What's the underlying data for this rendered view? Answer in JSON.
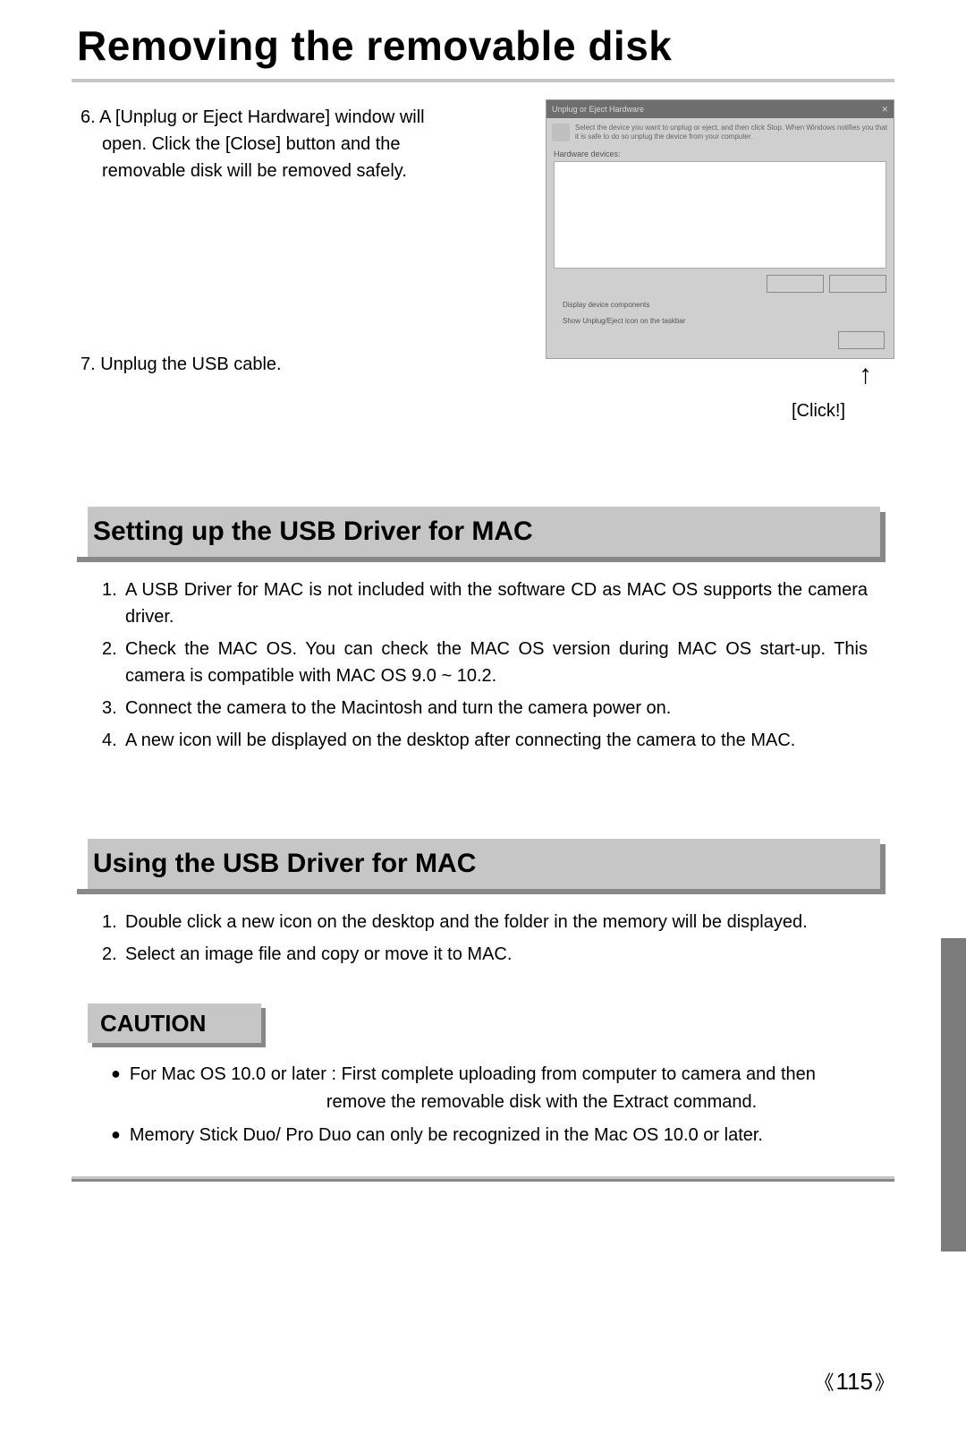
{
  "title": "Removing the removable disk",
  "step6": {
    "num": "6.",
    "line1": "A [Unplug or Eject Hardware] window will",
    "line2": "open. Click the [Close] button and the",
    "line3": "removable disk will be removed safely."
  },
  "step7": "7. Unplug the USB cable.",
  "screenshot": {
    "titlebar": "Unplug or Eject Hardware",
    "desc": "Select the device you want to unplug or eject, and then click Stop. When Windows notifies you that it is safe to do so unplug the device from your computer.",
    "label": "Hardware devices:",
    "check1": "Display device components",
    "check2": "Show Unplug/Eject icon on the taskbar",
    "click": "[Click!]"
  },
  "section1": {
    "heading": "Setting up the USB Driver for MAC",
    "i1": {
      "n": "1.",
      "t": "A USB Driver for MAC is not included with the software CD as MAC OS supports the camera driver."
    },
    "i2": {
      "n": "2.",
      "t": "Check the MAC OS. You can check the MAC OS version during MAC OS start-up. This camera is compatible with MAC OS 9.0 ~ 10.2."
    },
    "i3": {
      "n": "3.",
      "t": "Connect the camera to the Macintosh and turn the camera power on."
    },
    "i4": {
      "n": "4.",
      "t": "A new icon will be displayed on the desktop after connecting the camera to the MAC."
    }
  },
  "section2": {
    "heading": "Using the USB Driver for MAC",
    "i1": {
      "n": "1.",
      "t": "Double click a new icon on the desktop and the folder in the memory will be displayed."
    },
    "i2": {
      "n": "2.",
      "t": "Select an image file and copy or move it to MAC."
    }
  },
  "caution": {
    "heading": "CAUTION",
    "b1a": "For Mac OS 10.0 or later : First complete uploading from computer to camera and then",
    "b1b": "remove the removable disk with the Extract command.",
    "b2": "Memory Stick Duo/ Pro Duo can only be recognized in the Mac OS 10.0 or later."
  },
  "pageNumber": "115"
}
